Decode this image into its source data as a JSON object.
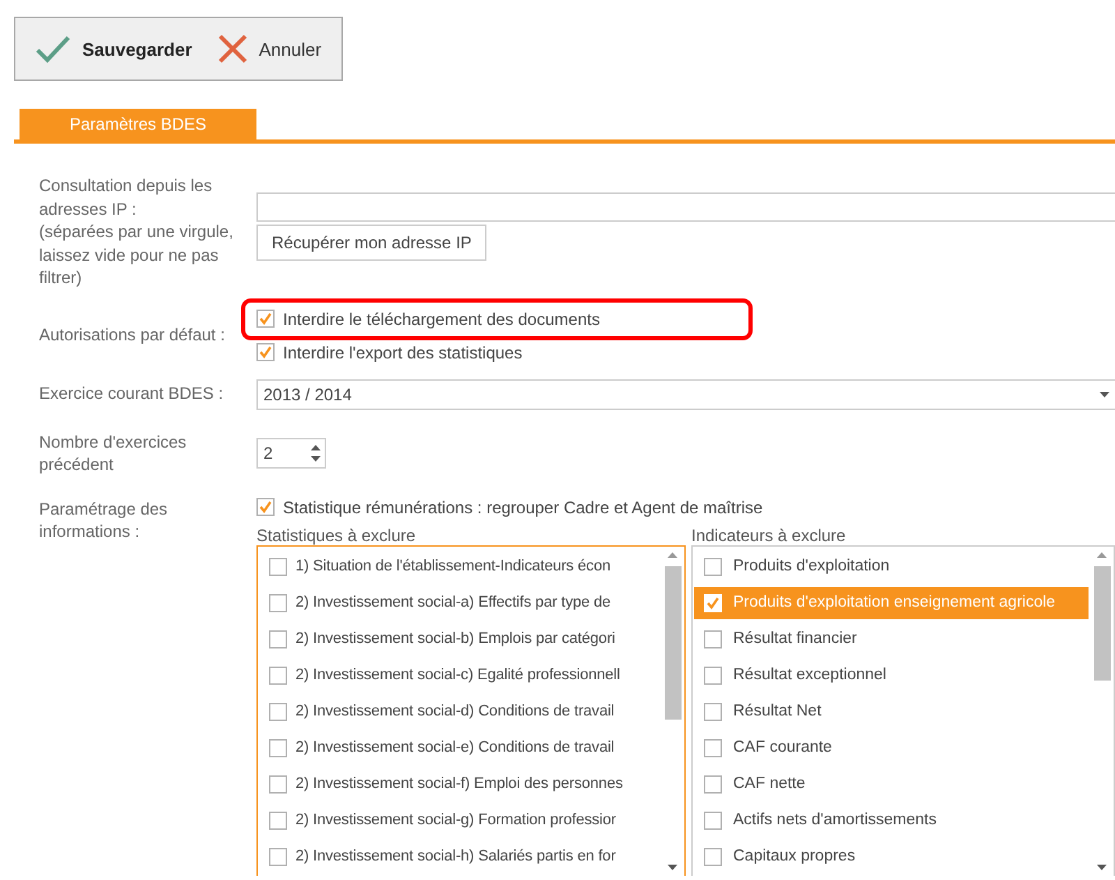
{
  "toolbar": [
    {
      "kind": "save",
      "label": "Sauvegarder"
    },
    {
      "kind": "cancel",
      "label": "Annuler"
    }
  ],
  "tabs": [
    {
      "label": "Paramètres BDES",
      "selected": true
    }
  ],
  "form": [
    {
      "kind": "ip",
      "label": "Consultation depuis les\nadresses IP :\n(séparées par une virgule,\nlaissez vide pour ne pas\nfiltrer)",
      "button": "Récupérer mon adresse IP"
    },
    {
      "kind": "checks",
      "label": "Autorisations par défaut :",
      "options": [
        {
          "label": "Interdire le téléchargement des documents",
          "checked": true,
          "highlighted": true
        },
        {
          "label": "Interdire l'export des statistiques",
          "checked": true,
          "highlighted": false
        }
      ]
    },
    {
      "kind": "select",
      "label": "Exercice courant BDES :",
      "value": "2013 / 2014"
    },
    {
      "kind": "spinner",
      "label": "Nombre d'exercices\nprécédent",
      "value": "2"
    },
    {
      "kind": "lists",
      "label": "Paramétrage des\ninformations :",
      "option": {
        "label": "Statistique rémunérations : regrouper Cadre et Agent de maîtrise",
        "checked": true
      },
      "lists": [
        {
          "title": "Statistiques à exclure",
          "focused": true,
          "items": [
            {
              "label": "1) Situation de l'établissement-Indicateurs écon",
              "checked": false,
              "selected": false
            },
            {
              "label": "2) Investissement social-a) Effectifs par type de",
              "checked": false,
              "selected": false
            },
            {
              "label": "2) Investissement social-b) Emplois par catégori",
              "checked": false,
              "selected": false
            },
            {
              "label": "2) Investissement social-c) Egalité professionnell",
              "checked": false,
              "selected": false
            },
            {
              "label": "2) Investissement social-d) Conditions de travail",
              "checked": false,
              "selected": false
            },
            {
              "label": "2) Investissement social-e) Conditions de travail",
              "checked": false,
              "selected": false
            },
            {
              "label": "2) Investissement social-f) Emploi des personnes",
              "checked": false,
              "selected": false
            },
            {
              "label": "2) Investissement social-g) Formation professior",
              "checked": false,
              "selected": false
            },
            {
              "label": "2) Investissement social-h) Salariés partis en for",
              "checked": false,
              "selected": false
            }
          ]
        },
        {
          "title": "Indicateurs à exclure",
          "focused": false,
          "items": [
            {
              "label": "Produits d'exploitation",
              "checked": false,
              "selected": false
            },
            {
              "label": "Produits d'exploitation enseignement agricole",
              "checked": true,
              "selected": true
            },
            {
              "label": "Résultat financier",
              "checked": false,
              "selected": false
            },
            {
              "label": "Résultat exceptionnel",
              "checked": false,
              "selected": false
            },
            {
              "label": "Résultat Net",
              "checked": false,
              "selected": false
            },
            {
              "label": "CAF courante",
              "checked": false,
              "selected": false
            },
            {
              "label": "CAF nette",
              "checked": false,
              "selected": false
            },
            {
              "label": "Actifs nets d'amortissements",
              "checked": false,
              "selected": false
            },
            {
              "label": "Capitaux propres",
              "checked": false,
              "selected": false
            }
          ]
        }
      ]
    }
  ]
}
